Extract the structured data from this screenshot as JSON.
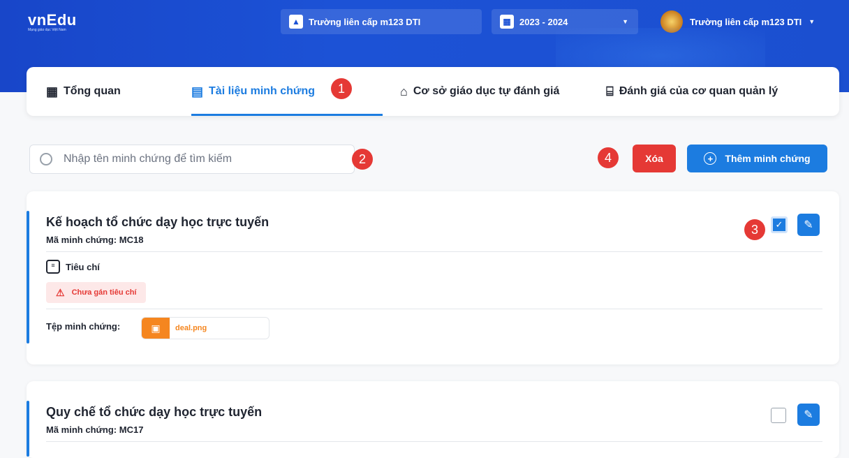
{
  "header": {
    "logo": "vnEdu",
    "logo_sub": "Mạng giáo dục Việt Nam",
    "school_select": "Trường liên cấp m123 DTI",
    "year_select": "2023 - 2024",
    "user_name": "Trường liên cấp m123 DTI"
  },
  "tabs": [
    {
      "label": "Tổng quan",
      "icon": "grid-icon"
    },
    {
      "label": "Tài liệu minh chứng",
      "icon": "document-icon",
      "active": true
    },
    {
      "label": "Cơ sở giáo dục tự đánh giá",
      "icon": "school-icon"
    },
    {
      "label": "Đánh giá của cơ quan quản lý",
      "icon": "bank-icon"
    }
  ],
  "search": {
    "placeholder": "Nhập tên minh chứng để tìm kiếm"
  },
  "toolbar": {
    "delete_label": "Xóa",
    "add_label": "Thêm minh chứng"
  },
  "annotations": [
    "1",
    "2",
    "3",
    "4"
  ],
  "cards": [
    {
      "title": "Kế hoạch tổ chức dạy học trực tuyến",
      "code": "Mã minh chứng: MC18",
      "checked": true,
      "criteria_label": "Tiêu chí",
      "criteria_warning": "Chưa gán tiêu chí",
      "file_label": "Tệp minh chứng:",
      "file_name": "deal.png"
    },
    {
      "title": "Quy chế tổ chức dạy học trực tuyến",
      "code": "Mã minh chứng: MC17",
      "checked": false
    }
  ],
  "colors": {
    "primary": "#1c7ce0",
    "danger": "#e53935",
    "header": "#1c52d6",
    "file": "#f5861f"
  }
}
